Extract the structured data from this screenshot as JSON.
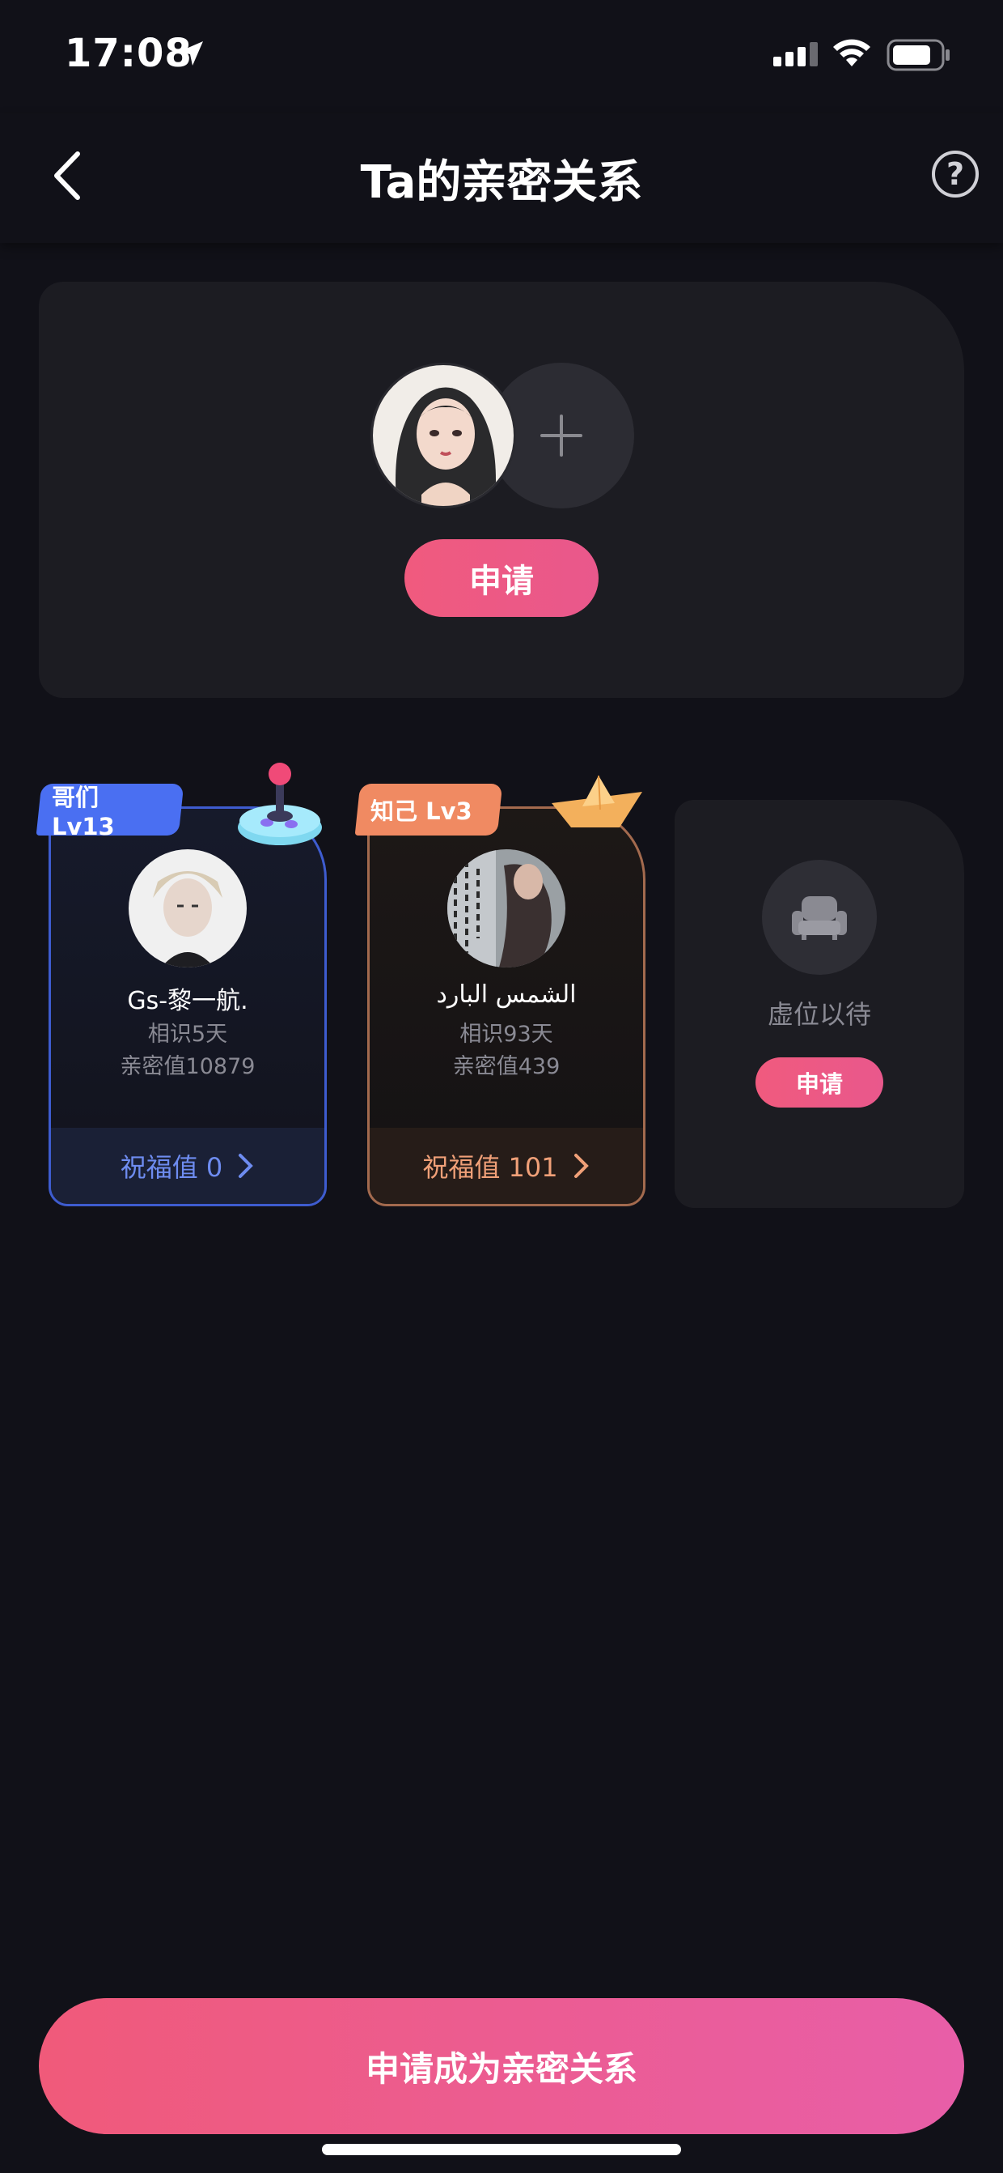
{
  "status_bar": {
    "time": "17:08"
  },
  "header": {
    "title": "Ta的亲密关系",
    "help_symbol": "?"
  },
  "top_card": {
    "apply_label": "申请"
  },
  "relations": [
    {
      "tag": "哥们 Lv13",
      "name": "Gs-黎一航.",
      "known_days": "相识5天",
      "intimacy": "亲密值10879",
      "blessing": "祝福值 0",
      "accent": "#4a6ff2"
    },
    {
      "tag": "知己 Lv3",
      "name": "الشمس البارد",
      "known_days": "相识93天",
      "intimacy": "亲密值439",
      "blessing": "祝福值 101",
      "accent": "#f08a62"
    }
  ],
  "empty_slot": {
    "label": "虚位以待",
    "apply_label": "申请"
  },
  "bottom_button": {
    "label": "申请成为亲密关系"
  },
  "colors": {
    "background": "#111118",
    "card": "#1c1c22",
    "pink": "#f05a7e"
  }
}
